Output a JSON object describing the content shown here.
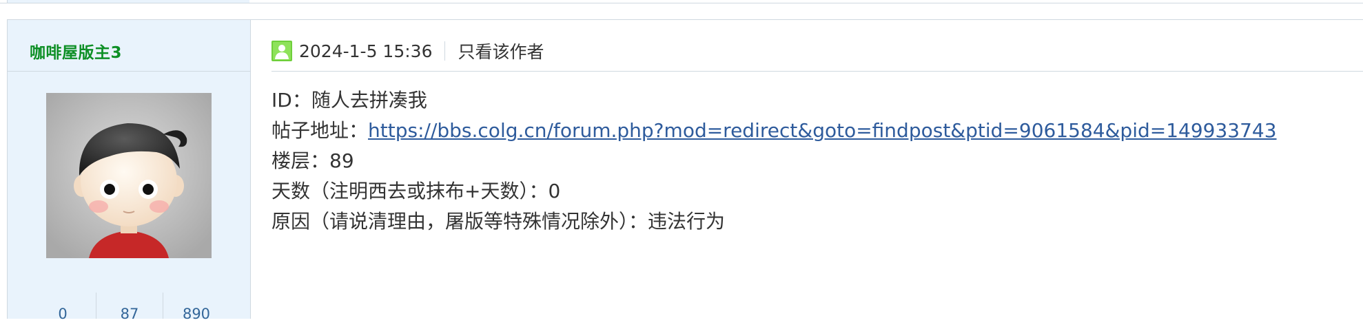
{
  "author": {
    "name": "咖啡屋版主3",
    "stats": [
      "0",
      "87",
      "890"
    ]
  },
  "post": {
    "time": "2024-1-5 15:36",
    "only_author_label": "只看该作者",
    "body": {
      "id_label": "ID：",
      "id_value": "随人去拼凑我",
      "url_label": "帖子地址：",
      "url_value": "https://bbs.colg.cn/forum.php?mod=redirect&goto=findpost&ptid=9061584&pid=149933743",
      "floor_label": "楼层：",
      "floor_value": "89",
      "days_label": "天数（注明西去或抹布+天数）：",
      "days_value": "0",
      "reason_label": "原因（请说清理由，屠版等特殊情况除外）：",
      "reason_value": "违法行为"
    }
  },
  "icons": {
    "online": "online-user-icon",
    "avatar": "cartoon-avatar"
  },
  "colors": {
    "author_name": "#0d8f25",
    "link": "#2e5b9c",
    "sidebar_bg": "#e9f3fc",
    "border": "#cfd8e0",
    "online_icon": "#6fcf3b"
  }
}
